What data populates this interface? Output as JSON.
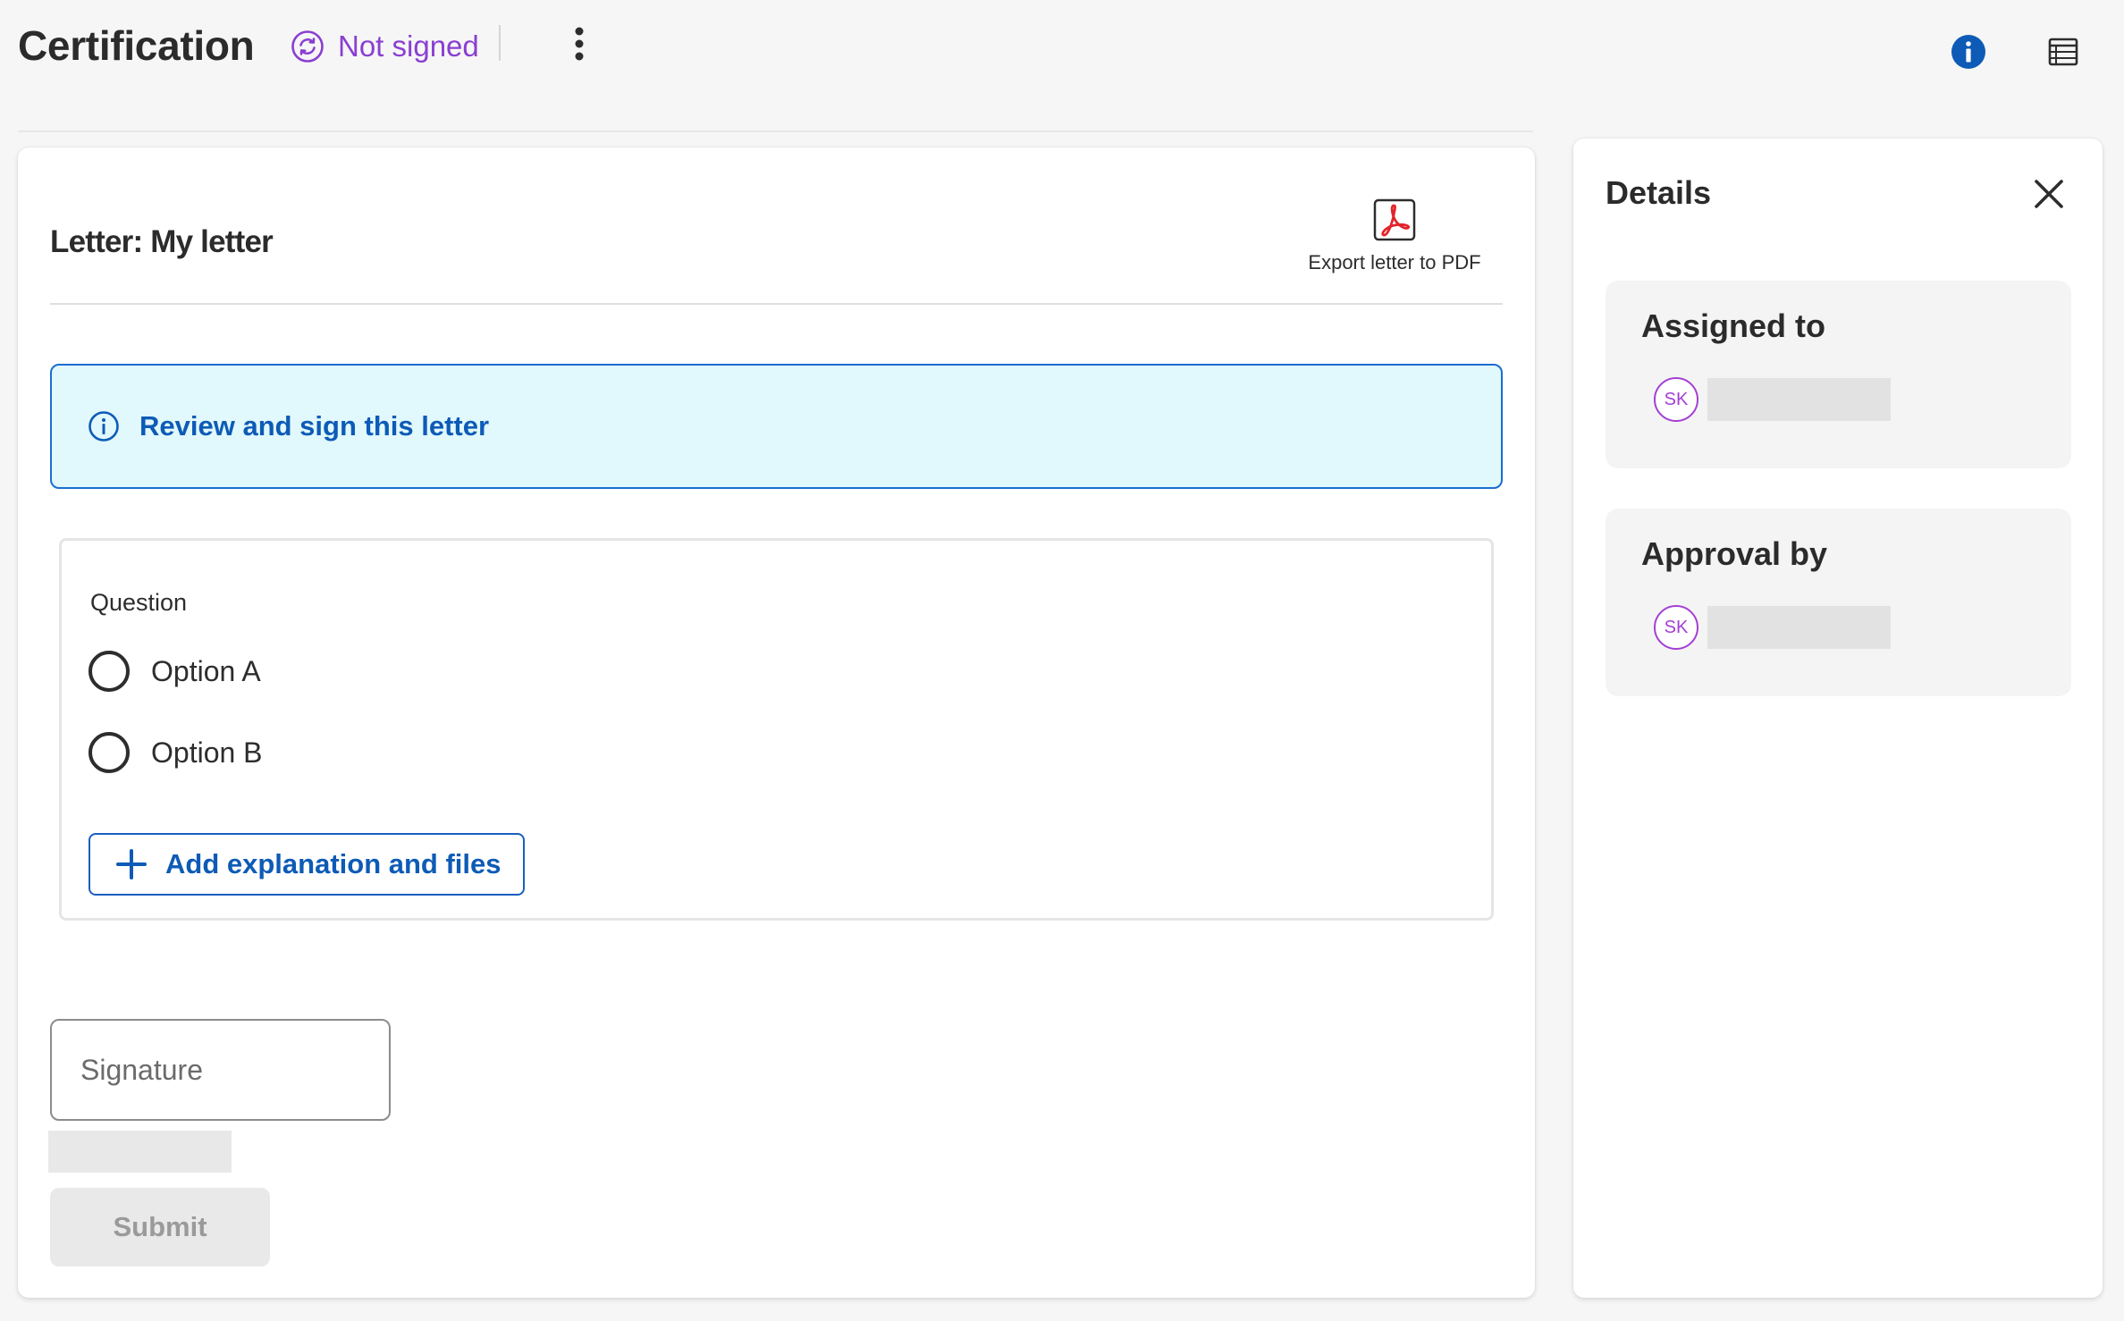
{
  "header": {
    "title": "Certification",
    "status_label": "Not signed",
    "more_icon": "kebab-vertical-icon",
    "info_icon": "info-icon",
    "table_icon": "table-view-icon",
    "status_color": "#8a3fd1"
  },
  "letter": {
    "title": "Letter: My letter",
    "export_label": "Export letter to PDF",
    "export_icon": "pdf-icon"
  },
  "alert": {
    "message": "Review and sign this letter",
    "icon": "info-outline-icon",
    "background": "#e1f8fc",
    "border": "#1a6ed0"
  },
  "question": {
    "label": "Question",
    "options": [
      "Option A",
      "Option B"
    ],
    "add_label": "Add explanation and files"
  },
  "signature": {
    "placeholder": "Signature",
    "submit_label": "Submit"
  },
  "details": {
    "title": "Details",
    "close_icon": "close-icon",
    "sections": [
      {
        "title": "Assigned to",
        "avatar_initials": "SK"
      },
      {
        "title": "Approval by",
        "avatar_initials": "SK"
      }
    ],
    "avatar_color": "#a43fd4"
  }
}
